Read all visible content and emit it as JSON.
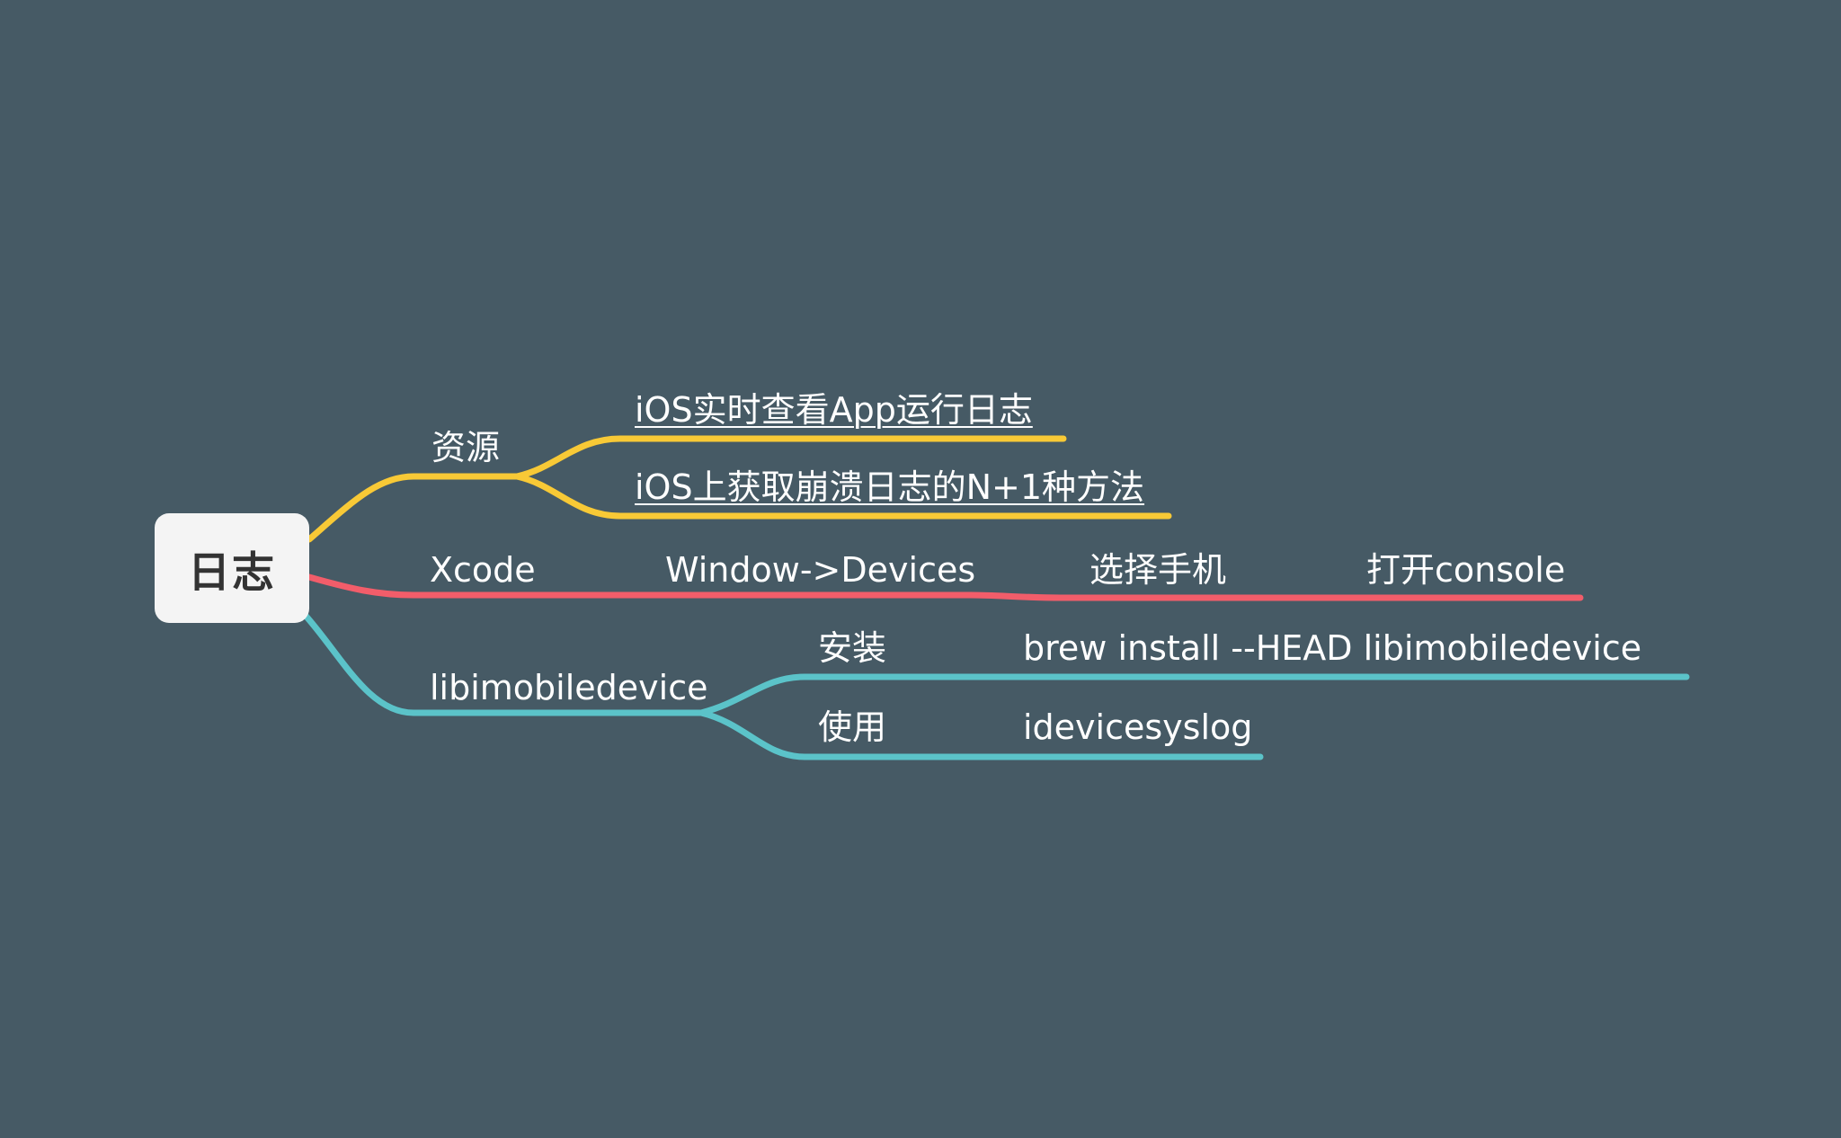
{
  "root": {
    "label": "日志"
  },
  "branches": {
    "resources": {
      "label": "资源",
      "color": "#f8c936",
      "links": [
        {
          "label": "iOS实时查看App运行日志"
        },
        {
          "label": "iOS上获取崩溃日志的N+1种方法"
        }
      ]
    },
    "xcode": {
      "label": "Xcode",
      "color": "#f25d6a",
      "steps": [
        {
          "label": "Window->Devices"
        },
        {
          "label": "选择手机"
        },
        {
          "label": "打开console"
        }
      ]
    },
    "libimobiledevice": {
      "label": "libimobiledevice",
      "color": "#5bc3c9",
      "children": [
        {
          "label": "安装",
          "detail": "brew install --HEAD libimobiledevice"
        },
        {
          "label": "使用",
          "detail": "idevicesyslog"
        }
      ]
    }
  }
}
